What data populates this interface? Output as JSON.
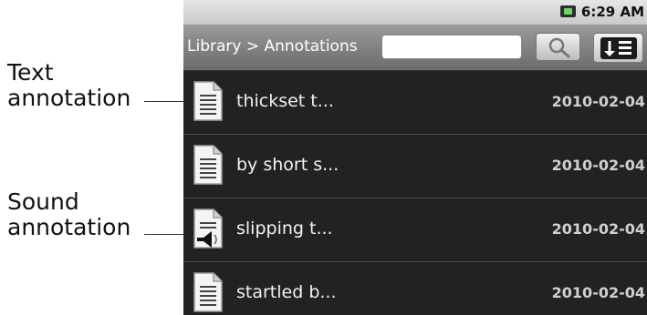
{
  "callouts": {
    "text_line1": "Text",
    "text_line2": "annotation",
    "sound_line1": "Sound",
    "sound_line2": "annotation"
  },
  "status_bar": {
    "time": "6:29 AM",
    "battery_icon": "battery-icon"
  },
  "title_bar": {
    "breadcrumb": "Library > Annotations",
    "search_value": "",
    "search_icon": "search-icon",
    "sort_icon": "sort-icon"
  },
  "annotations": [
    {
      "title": "thickset t...",
      "date": "2010-02-04",
      "type": "text",
      "icon": "document-icon"
    },
    {
      "title": "by short s...",
      "date": "2010-02-04",
      "type": "text",
      "icon": "document-icon"
    },
    {
      "title": "slipping t...",
      "date": "2010-02-04",
      "type": "sound",
      "icon": "sound-document-icon"
    },
    {
      "title": "startled b...",
      "date": "2010-02-04",
      "type": "text",
      "icon": "document-icon"
    }
  ],
  "colors": {
    "list_background": "#222222",
    "title_bar": "#7a7a7a",
    "status_bar": "#d4d4d4"
  }
}
